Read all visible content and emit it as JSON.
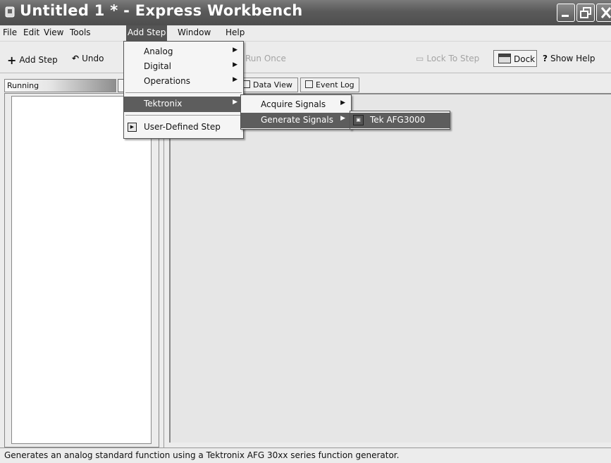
{
  "window": {
    "title": "Untitled 1 * - Express Workbench"
  },
  "menubar": {
    "items": [
      "File",
      "Edit",
      "View",
      "Tools",
      "Add Step",
      "Window",
      "Help"
    ],
    "active": "Add Step"
  },
  "toolbar": {
    "add_step_label": "Add Step",
    "undo_label": "Undo",
    "run_once_label": "Run Once",
    "lock_to_step_label": "Lock To Step",
    "dock_label": "Dock",
    "show_help_label": "Show Help"
  },
  "left_pane": {
    "status_label": "Running"
  },
  "tabs": [
    {
      "label": "Data View"
    },
    {
      "label": "Event Log"
    }
  ],
  "menus": {
    "add_step": {
      "items": [
        {
          "label": "Analog",
          "has_submenu": true
        },
        {
          "label": "Digital",
          "has_submenu": true
        },
        {
          "label": "Operations",
          "has_submenu": true
        },
        {
          "label": "Tektronix",
          "has_submenu": true,
          "highlighted": true
        },
        {
          "label": "User-Defined Step",
          "has_submenu": false
        }
      ]
    },
    "tektronix": {
      "items": [
        {
          "label": "Acquire Signals",
          "has_submenu": true
        },
        {
          "label": "Generate Signals",
          "has_submenu": true,
          "highlighted": true
        }
      ]
    },
    "generate_signals": {
      "items": [
        {
          "label": "Tek AFG3000",
          "highlighted": true
        }
      ]
    }
  },
  "statusbar": {
    "text": "Generates an analog standard function using a Tektronix AFG 30xx series function generator."
  },
  "colors": {
    "titlebar": "#5a5a5a",
    "highlight": "#5d5d5d",
    "menu_bg": "#f5f5f5"
  }
}
